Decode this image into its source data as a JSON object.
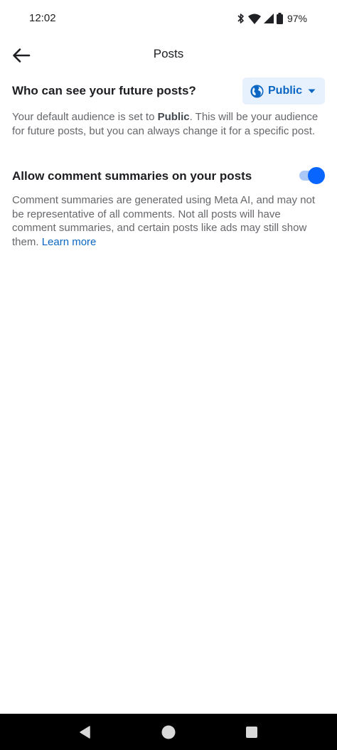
{
  "status_bar": {
    "time": "12:02",
    "battery": "97%",
    "icons": [
      "bluetooth-icon",
      "wifi-icon",
      "cellular-icon",
      "battery-icon"
    ]
  },
  "app_bar": {
    "title": "Posts",
    "back_icon": "arrow-left-icon"
  },
  "audience": {
    "heading": "Who can see your future posts?",
    "selected": "Public",
    "icon": "globe-icon",
    "description_prefix": "Your default audience is set to ",
    "description_bold": "Public",
    "description_suffix": ". This will be your audience for future posts, but you can always change it for a specific post."
  },
  "comment_summaries": {
    "heading": "Allow comment summaries on your posts",
    "enabled": true,
    "description": "Comment summaries are generated using Meta AI, and may not be representative of all comments. Not all posts will have comment summaries, and certain posts like ads may still show them. ",
    "learn_more": "Learn more"
  },
  "colors": {
    "accent": "#0866ff",
    "link": "#0a66c2",
    "dropdown_bg": "#e7f0fd",
    "secondary_text": "#65676b"
  },
  "nav_bar": {
    "buttons": [
      "back-triangle-icon",
      "home-circle-icon",
      "recents-square-icon"
    ]
  }
}
